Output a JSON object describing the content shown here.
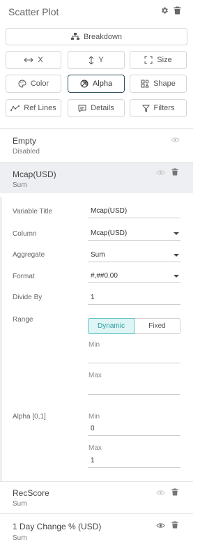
{
  "header": {
    "title": "Scatter Plot",
    "gear_icon": "gear-icon",
    "trash_icon": "trash-icon"
  },
  "buttons": {
    "breakdown": "Breakdown",
    "x": "X",
    "y": "Y",
    "size": "Size",
    "color": "Color",
    "alpha": "Alpha",
    "shape": "Shape",
    "ref_lines": "Ref Lines",
    "details": "Details",
    "filters": "Filters"
  },
  "variables": {
    "empty": {
      "name": "Empty",
      "sub": "Disabled"
    },
    "mcap": {
      "name": "Mcap(USD)",
      "sub": "Sum"
    },
    "recscore": {
      "name": "RecScore",
      "sub": "Sum"
    },
    "day_change": {
      "name": "1 Day Change % (USD)",
      "sub": "Sum"
    }
  },
  "settings": {
    "variable_title_label": "Variable Title",
    "variable_title_value": "Mcap(USD)",
    "column_label": "Column",
    "column_value": "Mcap(USD)",
    "aggregate_label": "Aggregate",
    "aggregate_value": "Sum",
    "format_label": "Format",
    "format_value": "#,##0.00",
    "divide_by_label": "Divide By",
    "divide_by_value": "1",
    "range_label": "Range",
    "range_dynamic": "Dynamic",
    "range_fixed": "Fixed",
    "range_min_label": "Min",
    "range_max_label": "Max",
    "alpha_label": "Alpha [0,1]",
    "alpha_min_label": "Min",
    "alpha_min_value": "0",
    "alpha_max_label": "Max",
    "alpha_max_value": "1"
  }
}
